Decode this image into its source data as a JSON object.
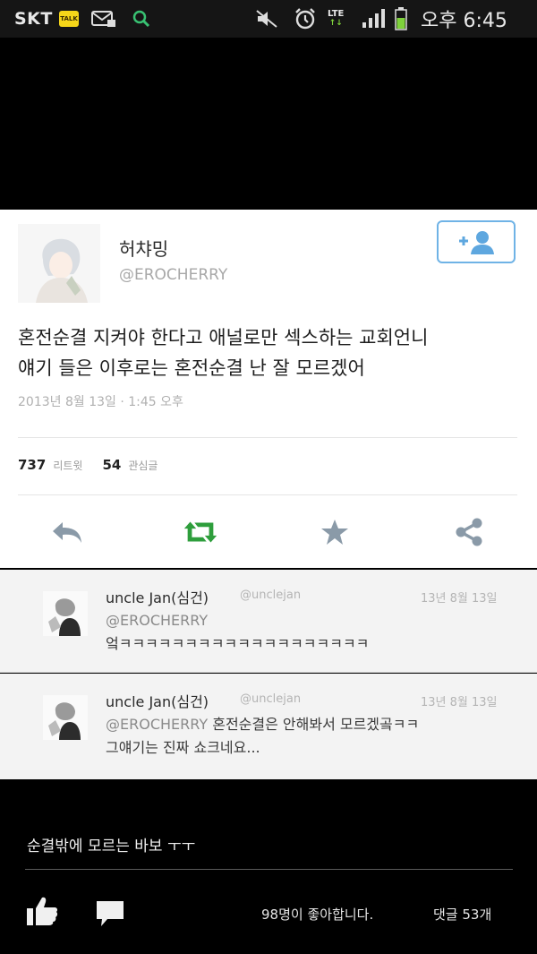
{
  "status_bar": {
    "carrier": "SKT",
    "talk_icon_text": "TALK",
    "lte": "LTE",
    "lte_arrows": "↑↓",
    "time": "오후 6:45"
  },
  "tweet": {
    "user_name": "허챠밍",
    "handle": "@EROCHERRY",
    "text_line1": "혼전순결 지켜야 한다고 애널로만 섹스하는 교회언니",
    "text_line2": "얘기 들은 이후로는 혼전순결 난 잘 모르겠어",
    "timestamp": "2013년 8월 13일 · 1:45 오후",
    "retweets": "737",
    "retweets_label": "리트윗",
    "favorites": "54",
    "favorites_label": "관심글",
    "colors": {
      "follow_border": "#6fb3e6",
      "retweet_green": "#2e9e3c",
      "action_gray": "#8a9aa8"
    }
  },
  "replies": [
    {
      "name": "uncle Jan(심건)",
      "handle": "@unclejan",
      "date": "13년 8월 13일",
      "mention": "@EROCHERRY",
      "text": "엌ㅋㅋㅋㅋㅋㅋㅋㅋㅋㅋㅋㅋㅋㅋㅋㅋㅋㅋㅋ"
    },
    {
      "name": "uncle Jan(심건)",
      "handle": "@unclejan",
      "date": "13년 8월 13일",
      "mention": "@EROCHERRY",
      "text": "혼전순결은 안해봐서 모르겠곸ㅋㅋ",
      "text2": "그얘기는 진짜 쇼크네요..."
    }
  ],
  "post": {
    "comment": "순결밖에 모르는 바보 ㅜㅜ",
    "likes": "98명이 좋아합니다.",
    "comments_count": "댓글 53개"
  }
}
